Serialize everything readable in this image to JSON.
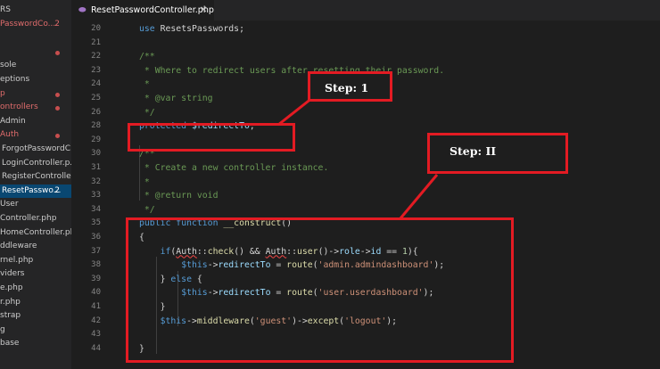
{
  "sidebar": {
    "items": [
      {
        "label": "RS",
        "style": "normal"
      },
      {
        "label": "PasswordCo...",
        "style": "red",
        "badge": "2"
      },
      {
        "label": "",
        "style": "normal"
      },
      {
        "label": "",
        "style": "red",
        "dot": true
      },
      {
        "label": "sole",
        "style": "normal"
      },
      {
        "label": "eptions",
        "style": "normal"
      },
      {
        "label": "p",
        "style": "red",
        "dot": true
      },
      {
        "label": "ontrollers",
        "style": "red",
        "dot": true
      },
      {
        "label": "Admin",
        "style": "normal"
      },
      {
        "label": "Auth",
        "style": "red",
        "dot": true
      },
      {
        "label": "ForgotPasswordC...",
        "style": "normal"
      },
      {
        "label": "LoginController.p...",
        "style": "normal"
      },
      {
        "label": "RegisterControlle...",
        "style": "normal"
      },
      {
        "label": "ResetPasswo...",
        "style": "selected",
        "badge": "2"
      },
      {
        "label": "User",
        "style": "normal"
      },
      {
        "label": "Controller.php",
        "style": "normal"
      },
      {
        "label": "HomeController.php",
        "style": "normal"
      },
      {
        "label": "ddleware",
        "style": "normal"
      },
      {
        "label": "rnel.php",
        "style": "normal"
      },
      {
        "label": "viders",
        "style": "normal"
      },
      {
        "label": "e.php",
        "style": "normal"
      },
      {
        "label": "r.php",
        "style": "normal"
      },
      {
        "label": "strap",
        "style": "normal"
      },
      {
        "label": "g",
        "style": "normal"
      },
      {
        "label": "base",
        "style": "normal"
      }
    ]
  },
  "tab": {
    "icon": "php-elephant-icon",
    "title": "ResetPasswordController.php",
    "close": "✕"
  },
  "editor": {
    "lines": [
      {
        "n": "20",
        "tokens": [
          [
            "k",
            "use"
          ],
          [
            "t",
            " ResetsPasswords;"
          ]
        ]
      },
      {
        "n": "21",
        "tokens": []
      },
      {
        "n": "22",
        "tokens": [
          [
            "c",
            "/**"
          ]
        ]
      },
      {
        "n": "23",
        "tokens": [
          [
            "c",
            " * Where to redirect users after resetting their password."
          ]
        ]
      },
      {
        "n": "24",
        "tokens": [
          [
            "c",
            " *"
          ]
        ]
      },
      {
        "n": "25",
        "tokens": [
          [
            "c",
            " * @var string"
          ]
        ]
      },
      {
        "n": "26",
        "tokens": [
          [
            "c",
            " */"
          ]
        ]
      },
      {
        "n": "28",
        "tokens": [
          [
            "k",
            "protected"
          ],
          [
            "t",
            " "
          ],
          [
            "v",
            "$redirectTo"
          ],
          [
            "t",
            ";"
          ]
        ]
      },
      {
        "n": "29",
        "tokens": []
      },
      {
        "n": "30",
        "tokens": [
          [
            "c",
            "/**"
          ]
        ]
      },
      {
        "n": "31",
        "tokens": [
          [
            "c",
            " * Create a new controller instance."
          ]
        ]
      },
      {
        "n": "32",
        "tokens": [
          [
            "c",
            " *"
          ]
        ]
      },
      {
        "n": "33",
        "tokens": [
          [
            "c",
            " * @return void"
          ]
        ]
      },
      {
        "n": "34",
        "tokens": [
          [
            "c",
            " */"
          ]
        ]
      },
      {
        "n": "35",
        "tokens": [
          [
            "k",
            "public"
          ],
          [
            "t",
            " "
          ],
          [
            "k",
            "function"
          ],
          [
            "t",
            " "
          ],
          [
            "f",
            "__construct"
          ],
          [
            "t",
            "()"
          ]
        ]
      },
      {
        "n": "36",
        "tokens": [
          [
            "t",
            "{"
          ]
        ]
      },
      {
        "n": "37",
        "tokens": [
          [
            "t",
            "    "
          ],
          [
            "k",
            "if"
          ],
          [
            "t",
            "("
          ],
          [
            "sq",
            "Auth"
          ],
          [
            "t",
            "::"
          ],
          [
            "f",
            "check"
          ],
          [
            "t",
            "() && "
          ],
          [
            "sq",
            "Auth"
          ],
          [
            "t",
            "::"
          ],
          [
            "f",
            "user"
          ],
          [
            "t",
            "()->"
          ],
          [
            "v",
            "role"
          ],
          [
            "t",
            "->"
          ],
          [
            "v",
            "id"
          ],
          [
            "t",
            " == "
          ],
          [
            "n",
            "1"
          ],
          [
            "t",
            "){"
          ]
        ]
      },
      {
        "n": "38",
        "tokens": [
          [
            "t",
            "        "
          ],
          [
            "k",
            "$this"
          ],
          [
            "t",
            "->"
          ],
          [
            "v",
            "redirectTo"
          ],
          [
            "t",
            " = "
          ],
          [
            "f",
            "route"
          ],
          [
            "t",
            "("
          ],
          [
            "s",
            "'admin.admindashboard'"
          ],
          [
            "t",
            ");"
          ]
        ]
      },
      {
        "n": "39",
        "tokens": [
          [
            "t",
            "    } "
          ],
          [
            "k",
            "else"
          ],
          [
            "t",
            " {"
          ]
        ]
      },
      {
        "n": "40",
        "tokens": [
          [
            "t",
            "        "
          ],
          [
            "k",
            "$this"
          ],
          [
            "t",
            "->"
          ],
          [
            "v",
            "redirectTo"
          ],
          [
            "t",
            " = "
          ],
          [
            "f",
            "route"
          ],
          [
            "t",
            "("
          ],
          [
            "s",
            "'user.userdashboard'"
          ],
          [
            "t",
            ");"
          ]
        ]
      },
      {
        "n": "41",
        "tokens": [
          [
            "t",
            "    }"
          ]
        ]
      },
      {
        "n": "42",
        "tokens": [
          [
            "t",
            "    "
          ],
          [
            "k",
            "$this"
          ],
          [
            "t",
            "->"
          ],
          [
            "f",
            "middleware"
          ],
          [
            "t",
            "("
          ],
          [
            "s",
            "'guest'"
          ],
          [
            "t",
            ")->"
          ],
          [
            "f",
            "except"
          ],
          [
            "t",
            "("
          ],
          [
            "s",
            "'logout'"
          ],
          [
            "t",
            ");"
          ]
        ]
      },
      {
        "n": "43",
        "tokens": []
      },
      {
        "n": "44",
        "tokens": [
          [
            "t",
            "}"
          ]
        ]
      }
    ]
  },
  "annotations": {
    "step1": "Step: 1",
    "step2": "Step: II"
  },
  "colors": {
    "annotation": "#e31b23",
    "editor_bg": "#1e1e1e",
    "sidebar_bg": "#252526",
    "selection": "#094771"
  }
}
